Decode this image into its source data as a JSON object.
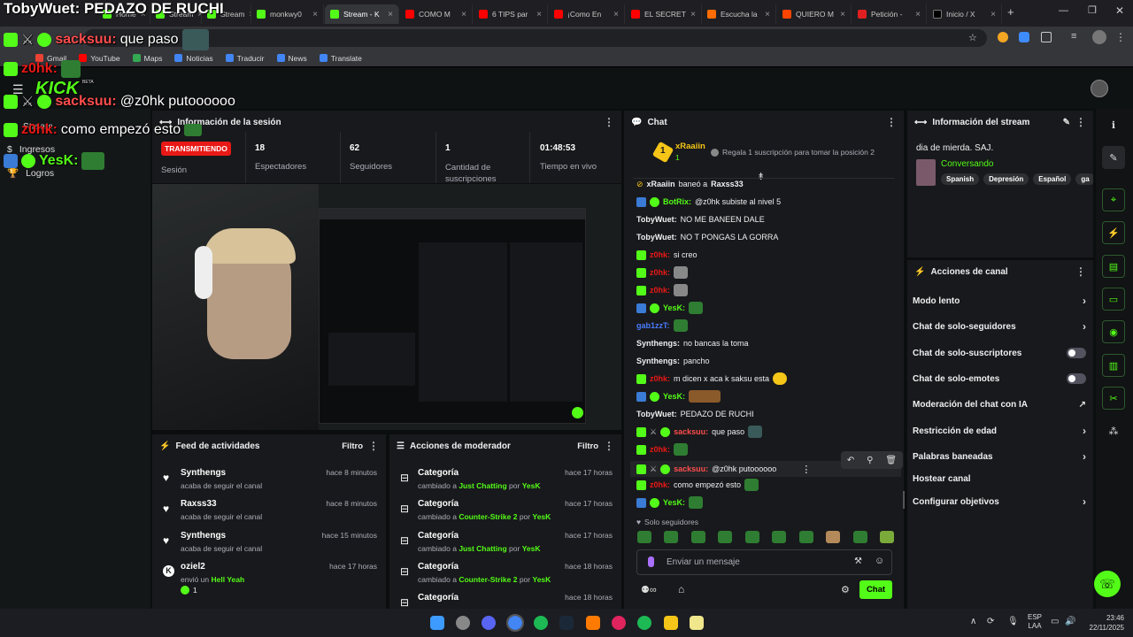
{
  "browser": {
    "tabs": [
      {
        "label": "Home"
      },
      {
        "label": "Stream"
      },
      {
        "label": "Stream"
      },
      {
        "label": "monkwy0"
      },
      {
        "label": "Stream - K"
      },
      {
        "label": "COMO M"
      },
      {
        "label": "6 TIPS par"
      },
      {
        "label": "¡Como En"
      },
      {
        "label": "EL SECRET"
      },
      {
        "label": "Escucha la"
      },
      {
        "label": "QUIERO M"
      },
      {
        "label": "Petición -"
      },
      {
        "label": "Inicio / X"
      }
    ],
    "bookmarks": [
      "Gmail",
      "YouTube",
      "Maps",
      "Noticias",
      "Traducir",
      "News",
      "Translate"
    ]
  },
  "overlay": {
    "title": "TobyWuet: PEDAZO DE RUCHI",
    "lines": [
      {
        "user": "sacksuu:",
        "text": " que paso",
        "color": "#ff4d4d"
      },
      {
        "user": "z0hk:",
        "text": "",
        "color": "#e91916"
      },
      {
        "user": "sacksuu:",
        "text": " @z0hk putoooooo",
        "color": "#ff4d4d"
      },
      {
        "user": "z0hk:",
        "text": " como empezó esto",
        "color": "#e91916"
      },
      {
        "user": "YesK:",
        "text": "",
        "color": "#53fc18"
      }
    ],
    "logo": "KICK",
    "logo_sub": "BETA"
  },
  "leftnav": {
    "items": [
      {
        "label": "Stream"
      },
      {
        "label": "Ingresos"
      },
      {
        "label": "Logros"
      }
    ]
  },
  "session": {
    "title": "Información de la sesión",
    "live_badge": "TRANSMITIENDO",
    "session_label": "Sesión",
    "stats": [
      {
        "value": "18",
        "label": "Espectadores"
      },
      {
        "value": "62",
        "label": "Seguidores"
      },
      {
        "value": "1",
        "label": "Cantidad de suscripciones"
      },
      {
        "value": "01:48:53",
        "label": "Tiempo en vivo"
      }
    ]
  },
  "feed": {
    "title": "Feed de actividades",
    "filter": "Filtro",
    "items": [
      {
        "name": "Synthengs",
        "sub": "acaba de seguir el canal",
        "time": "hace 8 minutos",
        "icon": "heart-icon"
      },
      {
        "name": "Raxss33",
        "sub": "acaba de seguir el canal",
        "time": "hace 8 minutos",
        "icon": "heart-icon"
      },
      {
        "name": "Synthengs",
        "sub": "acaba de seguir el canal",
        "time": "hace 15 minutos",
        "icon": "heart-icon"
      },
      {
        "name": "oziel2",
        "sub_prefix": "envió un",
        "sub_highlight": "Hell Yeah",
        "count": "1",
        "time": "hace 17 horas",
        "icon": "kick-icon"
      }
    ]
  },
  "mod": {
    "title": "Acciones de moderador",
    "filter": "Filtro",
    "items": [
      {
        "name": "Categoría",
        "prefix": "cambiado a",
        "cat": "Just Chatting",
        "by": "por",
        "user": "YesK",
        "time": "hace 17 horas"
      },
      {
        "name": "Categoría",
        "prefix": "cambiado a",
        "cat": "Counter-Strike 2",
        "by": "por",
        "user": "YesK",
        "time": "hace 17 horas"
      },
      {
        "name": "Categoría",
        "prefix": "cambiado a",
        "cat": "Just Chatting",
        "by": "por",
        "user": "YesK",
        "time": "hace 17 horas"
      },
      {
        "name": "Categoría",
        "prefix": "cambiado a",
        "cat": "Counter-Strike 2",
        "by": "por",
        "user": "YesK",
        "time": "hace 18 horas"
      },
      {
        "name": "Categoría",
        "prefix": "",
        "cat": "",
        "by": "",
        "user": "",
        "time": "hace 18 horas"
      }
    ]
  },
  "chat": {
    "title": "Chat",
    "top_user": "xRaaiin",
    "top_rank": "1",
    "top_sub_count": "1",
    "gift_text": "Regala 1 suscripción para tomar la posición 2",
    "messages": [
      {
        "user": "xRaaiin",
        "text": "baneó a",
        "extra": "Raxss33",
        "color": "#efeff1"
      },
      {
        "user": "BotRix:",
        "text": "@z0hk subiste al nivel 5",
        "color": "#53fc18"
      },
      {
        "user": "TobyWuet:",
        "text": "NO ME BANEEN DALE",
        "color": "#efeff1"
      },
      {
        "user": "TobyWuet:",
        "text": "NO T PONGAS LA GORRA",
        "color": "#efeff1"
      },
      {
        "user": "z0hk:",
        "text": "si creo",
        "color": "#e91916"
      },
      {
        "user": "z0hk:",
        "text": "",
        "color": "#e91916"
      },
      {
        "user": "z0hk:",
        "text": "",
        "color": "#e91916"
      },
      {
        "user": "YesK:",
        "text": "",
        "color": "#53fc18"
      },
      {
        "user": "gab1zzT:",
        "text": "",
        "color": "#4a7cff"
      },
      {
        "user": "Synthengs:",
        "text": "no bancas la toma",
        "color": "#efeff1"
      },
      {
        "user": "Synthengs:",
        "text": "pancho",
        "color": "#efeff1"
      },
      {
        "user": "z0hk:",
        "text": "m dicen x aca k saksu esta",
        "color": "#e91916"
      },
      {
        "user": "YesK:",
        "text": "",
        "color": "#53fc18"
      },
      {
        "user": "TobyWuet:",
        "text": "PEDAZO DE RUCHI",
        "color": "#efeff1"
      },
      {
        "user": "sacksuu:",
        "text": "que paso",
        "color": "#ff4d4d"
      },
      {
        "user": "z0hk:",
        "text": "",
        "color": "#e91916"
      },
      {
        "user": "sacksuu:",
        "text": "@z0hk putoooooo",
        "color": "#ff4d4d"
      },
      {
        "user": "z0hk:",
        "text": "como empezó esto",
        "color": "#e91916"
      },
      {
        "user": "YesK:",
        "text": "",
        "color": "#53fc18"
      }
    ],
    "followers_only": "Solo seguidores",
    "input_placeholder": "Enviar un mensaje",
    "send_label": "Chat"
  },
  "stream_info": {
    "title": "Información del stream",
    "stream_title": "dia de mierda. SAJ.",
    "category": "Conversando",
    "tags": [
      "Spanish",
      "Depresión",
      "Español",
      "ga"
    ]
  },
  "channel_actions": {
    "title": "Acciones de canal",
    "items": [
      {
        "label": "Modo lento",
        "kind": "chevron"
      },
      {
        "label": "Chat de solo-seguidores",
        "kind": "chevron"
      },
      {
        "label": "Chat de solo-suscriptores",
        "kind": "toggle"
      },
      {
        "label": "Chat de solo-emotes",
        "kind": "toggle"
      },
      {
        "label": "Moderación del chat con IA",
        "kind": "external"
      },
      {
        "label": "Restricción de edad",
        "kind": "chevron"
      },
      {
        "label": "Palabras baneadas",
        "kind": "chevron"
      },
      {
        "label": "Hostear canal",
        "kind": "none"
      },
      {
        "label": "Configurar objetivos",
        "kind": "chevron"
      }
    ]
  },
  "taskbar": {
    "lang": "ESP",
    "lang2": "LAA",
    "time": "23:46",
    "date": "22/11/2025"
  },
  "colors": {
    "accent": "#53fc18",
    "live": "#e91916",
    "panel": "#18191c",
    "bg": "#0b0e0f"
  }
}
